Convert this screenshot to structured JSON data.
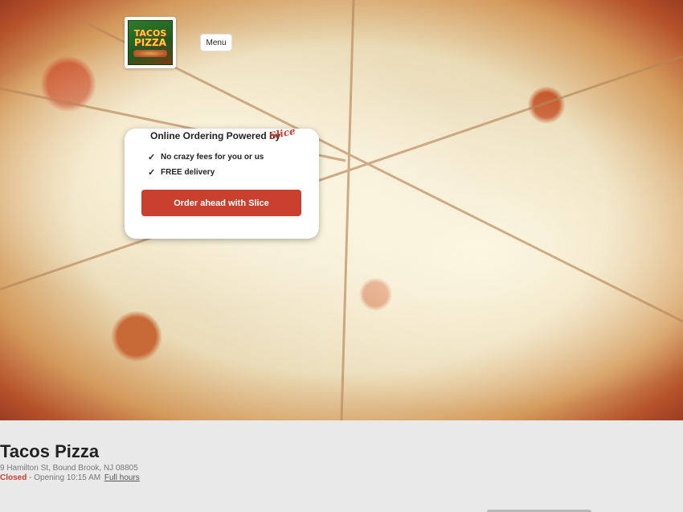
{
  "header": {
    "logo": {
      "line1": "TACOS",
      "line2": "PIZZA"
    },
    "menu_label": "Menu"
  },
  "promo": {
    "title": "Online Ordering Powered by",
    "brand": "Slice",
    "features": [
      {
        "check": "✓",
        "text": "No crazy fees for you or us"
      },
      {
        "check": "✓",
        "text": "FREE delivery"
      }
    ],
    "cta": "Order ahead with Slice"
  },
  "restaurant": {
    "name": "Tacos Pizza",
    "address": "9 Hamilton St, Bound Brook, NJ 08805",
    "status": "Closed",
    "opening": " - Opening 10:15 AM",
    "hours_link": "Full hours"
  },
  "colors": {
    "accent": "#c9402f",
    "background": "#e9e9e9"
  }
}
